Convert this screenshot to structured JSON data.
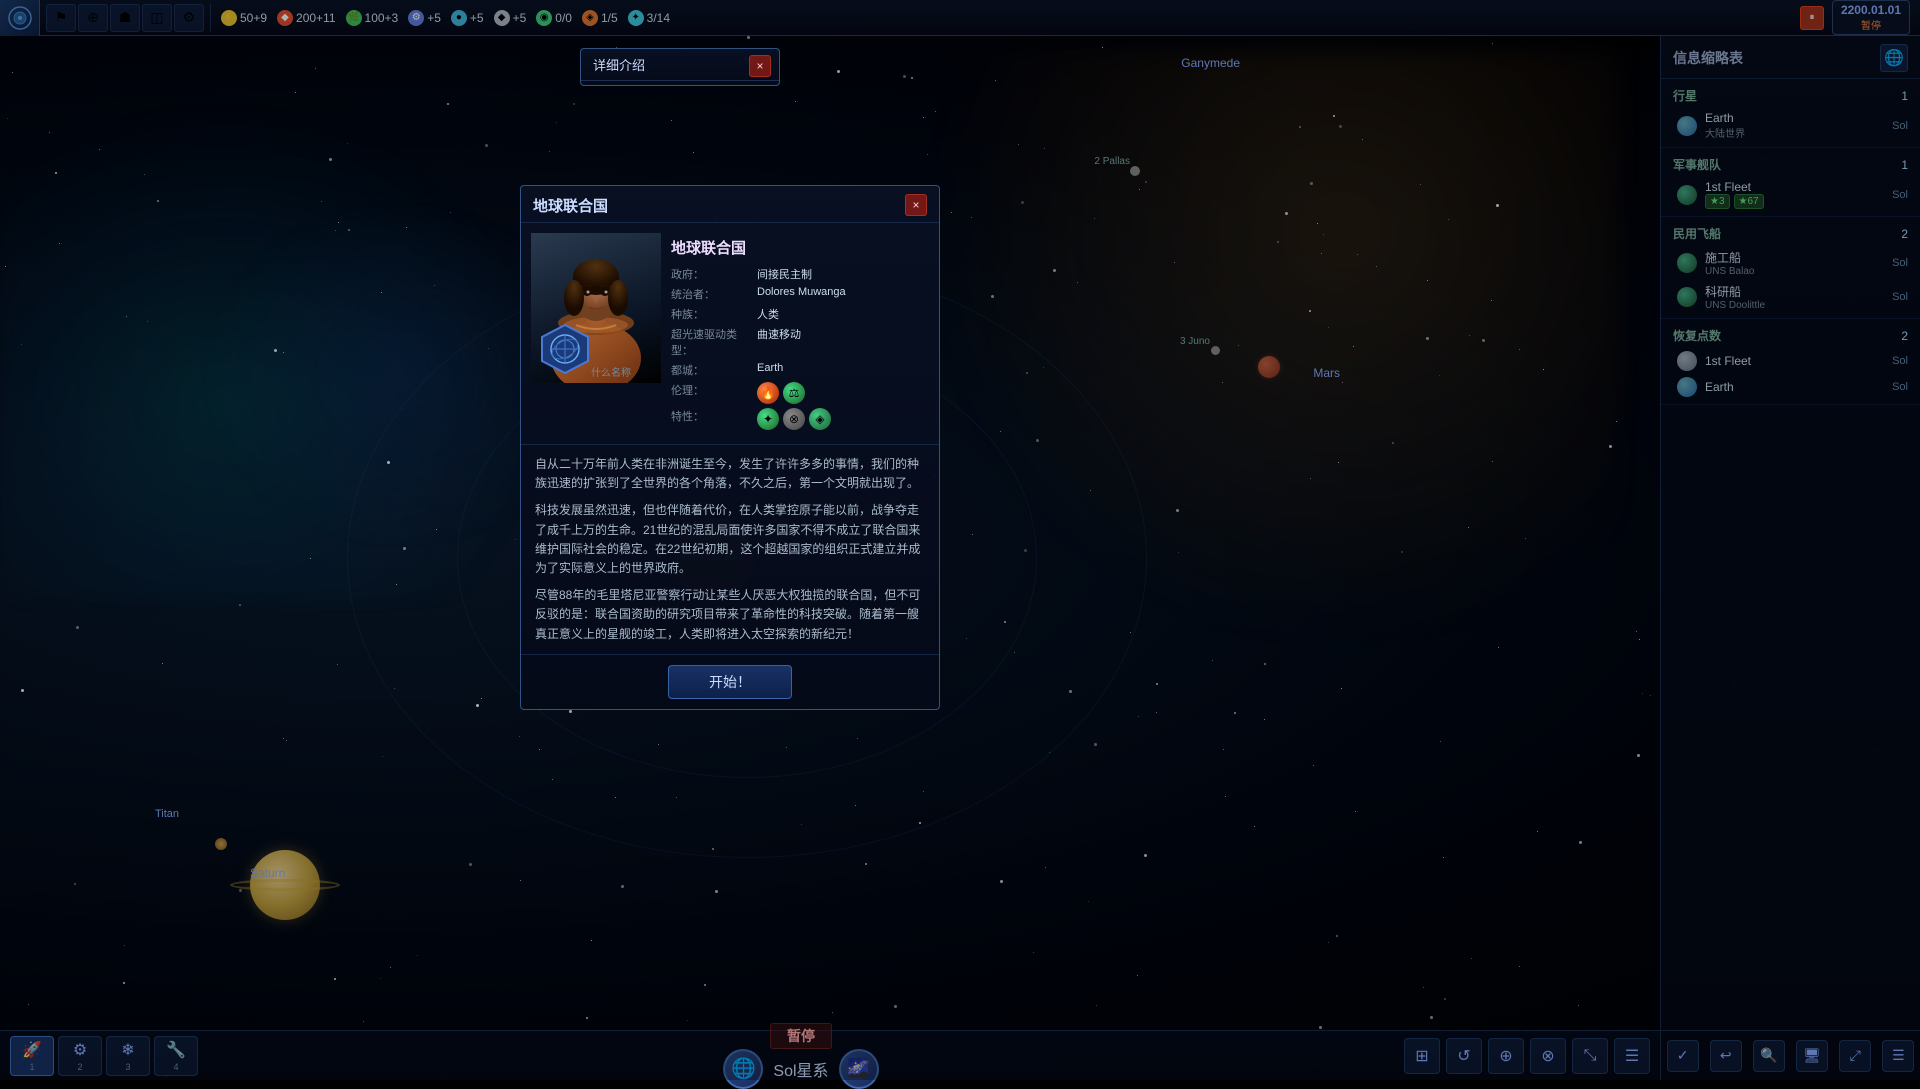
{
  "topbar": {
    "logo_icon": "game-logo",
    "resources": [
      {
        "id": "energy",
        "icon": "⚡",
        "value": "50+9",
        "class": "res-energy"
      },
      {
        "id": "minerals",
        "icon": "♦",
        "value": "200+11",
        "class": "res-minerals"
      },
      {
        "id": "food",
        "icon": "🌿",
        "value": "100+3",
        "class": "res-food"
      },
      {
        "id": "tech",
        "icon": "⚙",
        "value": "+5",
        "class": "res-tech"
      },
      {
        "id": "influence",
        "icon": "●",
        "value": "+5",
        "class": "res-influence"
      },
      {
        "id": "alloys",
        "icon": "◆",
        "value": "+5",
        "class": "res-alloys"
      },
      {
        "id": "consumer",
        "icon": "◉",
        "value": "0/0",
        "class": "res-consumer"
      },
      {
        "id": "unity",
        "icon": "◈",
        "value": "1/5",
        "class": "res-unity"
      },
      {
        "id": "amenities",
        "icon": "✦",
        "value": "3/14",
        "class": "res-amenities"
      }
    ],
    "date": "2200.01.01",
    "paused": "暂停"
  },
  "detail_modal": {
    "title": "详细介绍"
  },
  "faction_modal": {
    "title": "地球联合国",
    "close_label": "×",
    "government_label": "政府：",
    "government_value": "间接民主制",
    "ruler_label": "统治者：",
    "ruler_value": "Dolores Muwanga",
    "species_label": "种族：",
    "species_value": "人类",
    "ftl_label": "超光速驱动类型：",
    "ftl_value": "曲速移动",
    "capital_label": "都城：",
    "capital_value": "Earth",
    "ethics_label": "伦理：",
    "traits_label": "特性：",
    "missing_name": "什么名称",
    "description": [
      "自从二十万年前人类在非洲诞生至今，发生了许许多多的事情，我们的种族迅速的扩张到了全世界的各个角落，不久之后，第一个文明就出现了。",
      "科技发展虽然迅速，但也伴随着代价，在人类掌控原子能以前，战争夺走了成千上万的生命。21世纪的混乱局面使许多国家不得不成立了联合国来维护国际社会的稳定。在22世纪初期，这个超越国家的组织正式建立并成为了实际意义上的世界政府。",
      "尽管88年的毛里塔尼亚警察行动让某些人厌恶大权独揽的联合国，但不可反驳的是：联合国资助的研究项目带来了革命性的科技突破。随着第一艘真正意义上的星舰的竣工，人类即将进入太空探索的新纪元！"
    ],
    "start_button": "开始！"
  },
  "map": {
    "ganymede": "Ganymede",
    "mars": "Mars",
    "saturn": "Saturn",
    "titan": "Titan",
    "pallas": "2 Pallas",
    "juno": "3 Juno"
  },
  "sidebar": {
    "title": "信息缩略表",
    "sections": [
      {
        "label": "行星",
        "count": "1",
        "items": [
          {
            "name": "Earth",
            "sub": "大陆世界",
            "loc": "Sol",
            "icon_color": "#4a9ad4"
          }
        ]
      },
      {
        "label": "军事舰队",
        "count": "1",
        "items": [
          {
            "name": "1st Fleet",
            "sub": "★3  ★67",
            "loc": "Sol",
            "icon_color": "#4a8060"
          }
        ]
      },
      {
        "label": "民用飞船",
        "count": "2",
        "items": [
          {
            "name": "施工船",
            "sub": "UNS Balao",
            "loc": "Sol",
            "icon_color": "#4a8060"
          },
          {
            "name": "科研船",
            "sub": "UNS Doolittle",
            "loc": "Sol",
            "icon_color": "#4a8060"
          }
        ]
      },
      {
        "label": "恢复点数",
        "count": "2",
        "items": [
          {
            "name": "1st Fleet",
            "sub": "",
            "loc": "Sol",
            "icon_color": "#788090"
          },
          {
            "name": "Earth",
            "sub": "",
            "loc": "Sol",
            "icon_color": "#4a9ad4"
          }
        ]
      }
    ]
  },
  "bottombar": {
    "tabs": [
      {
        "num": "1",
        "icon": "🚀"
      },
      {
        "num": "2",
        "icon": "⚙"
      },
      {
        "num": "3",
        "icon": "❄"
      },
      {
        "num": "4",
        "icon": "🔧"
      }
    ],
    "paused_label": "暂停",
    "system_name": "Sol星系",
    "system_icon": "🌐"
  }
}
